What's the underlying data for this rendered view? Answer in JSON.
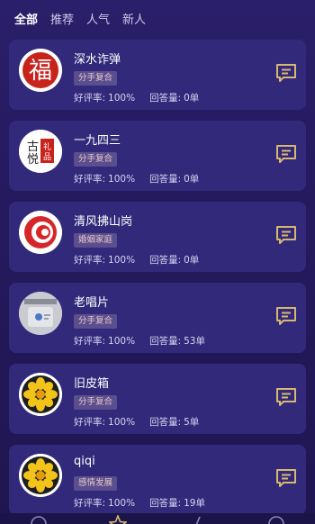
{
  "tabs": [
    {
      "label": "全部",
      "active": true
    },
    {
      "label": "推荐",
      "active": false
    },
    {
      "label": "人气",
      "active": false
    },
    {
      "label": "新人",
      "active": false
    }
  ],
  "labels": {
    "rating": "好评率:",
    "answers": "回答量:"
  },
  "cards": [
    {
      "name": "深水诈弹",
      "tag": "分手复合",
      "rating": "100%",
      "answers": "0单",
      "avatar": "fu-character-icon"
    },
    {
      "name": "一九四三",
      "tag": "分手复合",
      "rating": "100%",
      "answers": "0单",
      "avatar": "calligraphy-stamp-icon"
    },
    {
      "name": "清风拂山岗",
      "tag": "婚姻家庭",
      "rating": "100%",
      "answers": "0单",
      "avatar": "red-swirl-icon"
    },
    {
      "name": "老唱片",
      "tag": "分手复合",
      "rating": "100%",
      "answers": "53单",
      "avatar": "phone-photo-icon"
    },
    {
      "name": "旧皮箱",
      "tag": "分手复合",
      "rating": "100%",
      "answers": "5单",
      "avatar": "yellow-flower-icon"
    },
    {
      "name": "qiqi",
      "tag": "感情发展",
      "rating": "100%",
      "answers": "19单",
      "avatar": "yellow-flower-icon"
    }
  ],
  "colors": {
    "background": "#251a5e",
    "card": "#32297a",
    "tag_bg": "#5a4e8e",
    "chat_icon": "#d8b870"
  }
}
